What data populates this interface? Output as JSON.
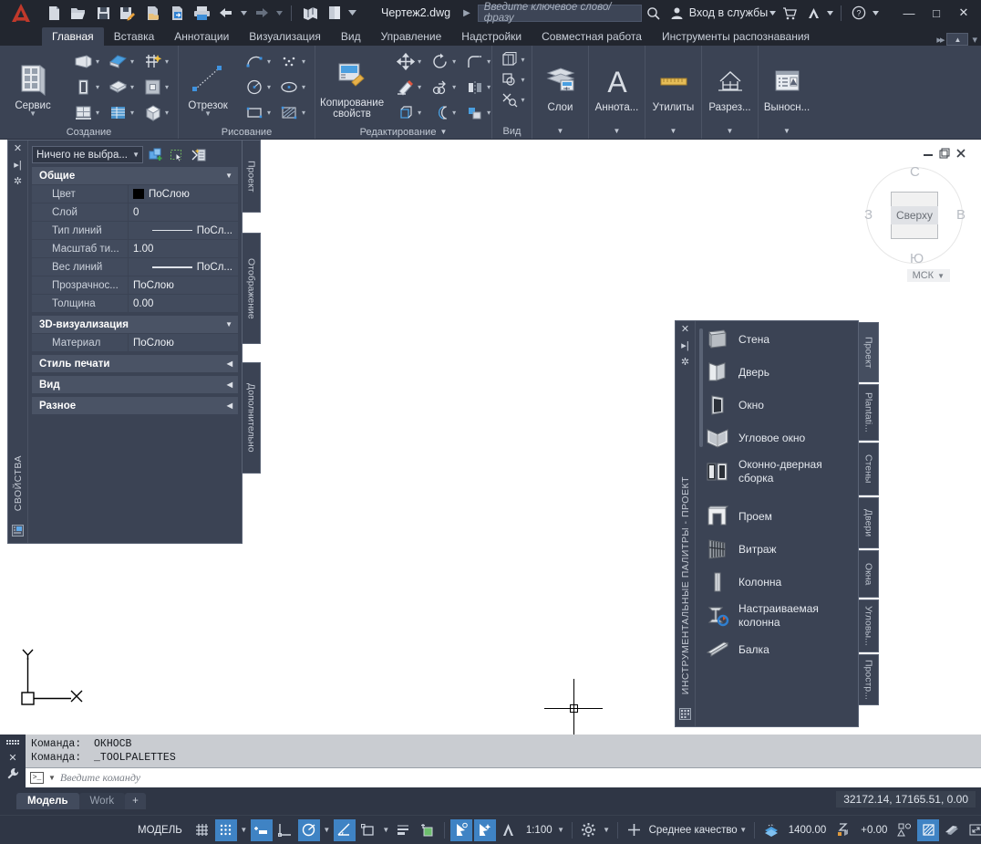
{
  "titlebar": {
    "document_title": "Чертеж2.dwg",
    "search_placeholder": "Введите ключевое слово/фразу",
    "signin_label": "Вход в службы",
    "quick_access": [
      {
        "name": "new-file",
        "icon": "page-icon"
      },
      {
        "name": "open-file",
        "icon": "folder-open-icon"
      },
      {
        "name": "save-file",
        "icon": "floppy-icon"
      },
      {
        "name": "save-as",
        "icon": "floppy-pencil-icon"
      },
      {
        "name": "open-from-web",
        "icon": "page-cloud-icon"
      },
      {
        "name": "save-to-web",
        "icon": "page-arrow-icon"
      },
      {
        "name": "plot",
        "icon": "printer-icon"
      },
      {
        "name": "undo",
        "icon": "undo-arrow-icon"
      },
      {
        "name": "redo",
        "icon": "redo-arrow-icon"
      },
      {
        "name": "sheet-set-manager",
        "icon": "chart-icon"
      },
      {
        "name": "layer-state",
        "icon": "layers-panel-icon"
      }
    ],
    "window_controls": {
      "minimize": "—",
      "maximize": "□",
      "close": "✕"
    }
  },
  "ribbon": {
    "tabs": [
      {
        "label": "Главная",
        "active": true
      },
      {
        "label": "Вставка",
        "active": false
      },
      {
        "label": "Аннотации",
        "active": false
      },
      {
        "label": "Визуализация",
        "active": false
      },
      {
        "label": "Вид",
        "active": false
      },
      {
        "label": "Управление",
        "active": false
      },
      {
        "label": "Надстройки",
        "active": false
      },
      {
        "label": "Совместная работа",
        "active": false
      },
      {
        "label": "Инструменты распознавания",
        "active": false
      }
    ],
    "panels": [
      {
        "title": "Создание",
        "big_button": {
          "label": "Сервис",
          "icon": "build-tool-icon"
        },
        "tools": [
          "wall-icon",
          "roof-icon",
          "grid-star-icon",
          "door-icon",
          "slab-icon",
          "ceiling-grid-icon",
          "window-icon",
          "stair-icon",
          "mass-element-icon"
        ]
      },
      {
        "title": "Рисование",
        "big_button": {
          "label": "Отрезок",
          "icon": "line-icon"
        },
        "tools": [
          "arc-icon",
          "point-icon",
          "circle-icon",
          "ellipse-icon",
          "rectangle-icon",
          "hatch-icon"
        ]
      },
      {
        "title": "Редактирование",
        "big_button": {
          "label": "Копирование свойств",
          "icon": "match-properties-icon"
        },
        "tools": [
          "move-icon",
          "rotate-icon",
          "fillet-icon",
          "erase-icon",
          "copy-icon",
          "mirror-icon",
          "extrude-icon",
          "offset-icon",
          "array-icon"
        ]
      },
      {
        "title": "Вид",
        "tools": [
          "3d-view-icon",
          "clip-icon",
          "section-icon"
        ]
      },
      {
        "title": "",
        "big_button": {
          "label": "Слои",
          "icon": "layers-icon"
        }
      },
      {
        "title": "",
        "big_button": {
          "label": "Аннота...",
          "icon": "text-a-icon"
        }
      },
      {
        "title": "",
        "big_button": {
          "label": "Утилиты",
          "icon": "ruler-icon"
        }
      },
      {
        "title": "",
        "big_button": {
          "label": "Разрез...",
          "icon": "section-house-icon"
        }
      },
      {
        "title": "",
        "big_button": {
          "label": "Выносн...",
          "icon": "callout-icon"
        }
      }
    ]
  },
  "properties_palette": {
    "vertical_title": "СВОЙСТВА",
    "selector_value": "Ничего не выбра...",
    "toolbar_icons": [
      "quick-select-icon",
      "select-objects-icon",
      "quick-calc-icon"
    ],
    "groups": [
      {
        "name": "Общие",
        "expanded": true,
        "rows": [
          {
            "label": "Цвет",
            "value": "ПоСлою",
            "kind": "color"
          },
          {
            "label": "Слой",
            "value": "0",
            "kind": "text"
          },
          {
            "label": "Тип линий",
            "value": "ПоСл...",
            "kind": "linetype"
          },
          {
            "label": "Масштаб ти...",
            "value": "1.00",
            "kind": "text"
          },
          {
            "label": "Вес линий",
            "value": "ПоСл...",
            "kind": "lineweight"
          },
          {
            "label": "Прозрачнос...",
            "value": "ПоСлою",
            "kind": "text"
          },
          {
            "label": "Толщина",
            "value": "0.00",
            "kind": "text"
          }
        ]
      },
      {
        "name": "3D-визуализация",
        "expanded": true,
        "rows": [
          {
            "label": "Материал",
            "value": "ПоСлою",
            "kind": "text"
          }
        ]
      },
      {
        "name": "Стиль печати",
        "expanded": false,
        "rows": []
      },
      {
        "name": "Вид",
        "expanded": false,
        "rows": []
      },
      {
        "name": "Разное",
        "expanded": false,
        "rows": []
      }
    ],
    "anchor_tabs": [
      "Проект",
      "Отображение",
      "Дополнительно"
    ]
  },
  "tool_palette": {
    "vertical_title": "ИНСТРУМЕНТАЛЬНЫЕ ПАЛИТРЫ - ПРОЕКТ",
    "vertical_title_short": "ПРОЕКТ",
    "items": [
      {
        "label": "Стена",
        "icon": "wall-tool-icon"
      },
      {
        "label": "Дверь",
        "icon": "door-tool-icon"
      },
      {
        "label": "Окно",
        "icon": "window-tool-icon"
      },
      {
        "label": "Угловое окно",
        "icon": "corner-window-tool-icon"
      },
      {
        "label": "Оконно-дверная сборка",
        "icon": "door-window-assembly-icon"
      },
      {
        "label": "Проем",
        "icon": "opening-tool-icon"
      },
      {
        "label": "Витраж",
        "icon": "curtain-wall-icon"
      },
      {
        "label": "Колонна",
        "icon": "column-tool-icon"
      },
      {
        "label": "Настраиваемая колонна",
        "icon": "custom-column-icon"
      },
      {
        "label": "Балка",
        "icon": "beam-tool-icon"
      }
    ],
    "tabs": [
      "Проект",
      "Plantati...",
      "Стены",
      "Двери",
      "Окна",
      "Угловы...",
      "Простр..."
    ]
  },
  "viewcube": {
    "face_label": "Сверху",
    "north": "С",
    "south": "Ю",
    "east": "В",
    "west": "З",
    "ucs_label": "МСК"
  },
  "ucs_icon": {
    "x_label": "X",
    "y_label": "Y"
  },
  "command_line": {
    "history": [
      "Команда:  ОКНОСВ",
      "Команда:  _TOOLPALETTES"
    ],
    "input_placeholder": "Введите  команду"
  },
  "layout_tabs": {
    "tabs": [
      {
        "label": "Модель",
        "active": true
      },
      {
        "label": "Work",
        "active": false
      }
    ],
    "add_label": "+",
    "coordinates": "32172.14, 17165.51, 0.00"
  },
  "status_bar": {
    "space_label": "МОДЕЛЬ",
    "annotation_scale": "1:100",
    "visual_quality": "Среднее качество",
    "elevation": "1400.00",
    "z_offset": "+0.00",
    "toggles": [
      {
        "name": "grid-display",
        "on": false
      },
      {
        "name": "snap-mode",
        "on": true
      },
      {
        "name": "infer-constraints",
        "on": true
      },
      {
        "name": "ortho-mode",
        "on": false
      },
      {
        "name": "polar-tracking",
        "on": true
      },
      {
        "name": "object-snap",
        "on": true
      },
      {
        "name": "object-snap-tracking",
        "on": false
      },
      {
        "name": "lineweight-display",
        "on": false
      },
      {
        "name": "transparency-display",
        "on": false
      },
      {
        "name": "selection-cycling",
        "on": true
      },
      {
        "name": "annotation-visibility",
        "on": true
      },
      {
        "name": "autoscale",
        "on": true
      },
      {
        "name": "workspace-switching",
        "on": false
      },
      {
        "name": "isolate-objects",
        "on": false
      },
      {
        "name": "hardware-accel",
        "on": true
      },
      {
        "name": "graphics-perf",
        "on": false
      },
      {
        "name": "clean-screen",
        "on": false
      },
      {
        "name": "customization",
        "on": false
      }
    ]
  },
  "colors": {
    "accent": "#3f83c4",
    "panel_bg": "#3b4354",
    "titlebar_bg": "#22262f",
    "canvas_bg": "#ffffff",
    "text": "#e4e8ee"
  }
}
